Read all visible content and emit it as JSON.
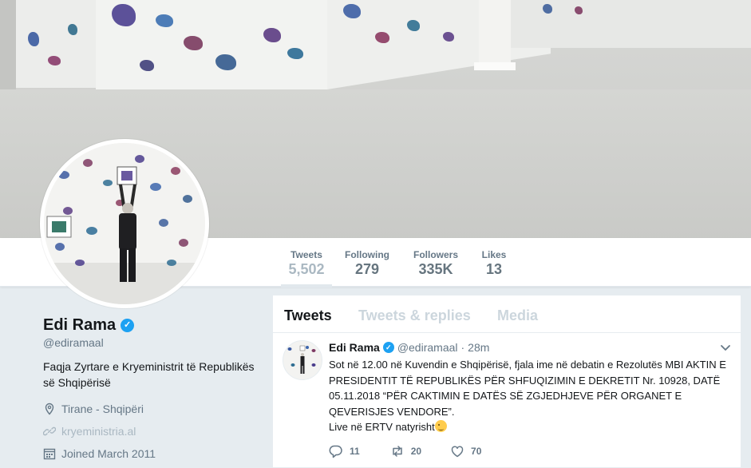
{
  "profile": {
    "name": "Edi Rama",
    "handle": "@ediramaal",
    "bio": "Faqja Zyrtare e Kryeministrit të Republikës së Shqipërisë",
    "location": "Tirane - Shqipëri",
    "website": "kryeministria.al",
    "joined": "Joined March 2011"
  },
  "stats": [
    {
      "label": "Tweets",
      "value": "5,502"
    },
    {
      "label": "Following",
      "value": "279"
    },
    {
      "label": "Followers",
      "value": "335K"
    },
    {
      "label": "Likes",
      "value": "13"
    }
  ],
  "tabs": [
    {
      "label": "Tweets"
    },
    {
      "label": "Tweets & replies"
    },
    {
      "label": "Media"
    }
  ],
  "tweet": {
    "name": "Edi Rama",
    "handle": "@ediramaal",
    "separator": "·",
    "time": "28m",
    "text": "Sot në 12.00 në Kuvendin e Shqipërisë, fjala ime në debatin e Rezolutës MBI AKTIN E PRESIDENTIT TË REPUBLIKËS PËR SHFUQIZIMIN E DEKRETIT Nr. 10928, DATË 05.11.2018 “PËR CAKTIMIN E DATËS SË ZGJEDHJEVE PËR ORGANET E QEVERISJES VENDORE”.\nLive në ERTV natyrisht",
    "emoji": "winking-face",
    "replies": "11",
    "retweets": "20",
    "likes": "70"
  },
  "icons": {
    "verified": "verified-badge-icon",
    "location": "location-pin-icon",
    "link": "link-icon",
    "calendar": "calendar-icon",
    "reply": "reply-icon",
    "retweet": "retweet-icon",
    "like": "heart-icon",
    "caret": "chevron-down-icon"
  },
  "colors": {
    "accent": "#1da1f2",
    "text": "#14171a",
    "secondary": "#657786",
    "muted": "#aab8c2",
    "background": "#e6ecf0"
  }
}
